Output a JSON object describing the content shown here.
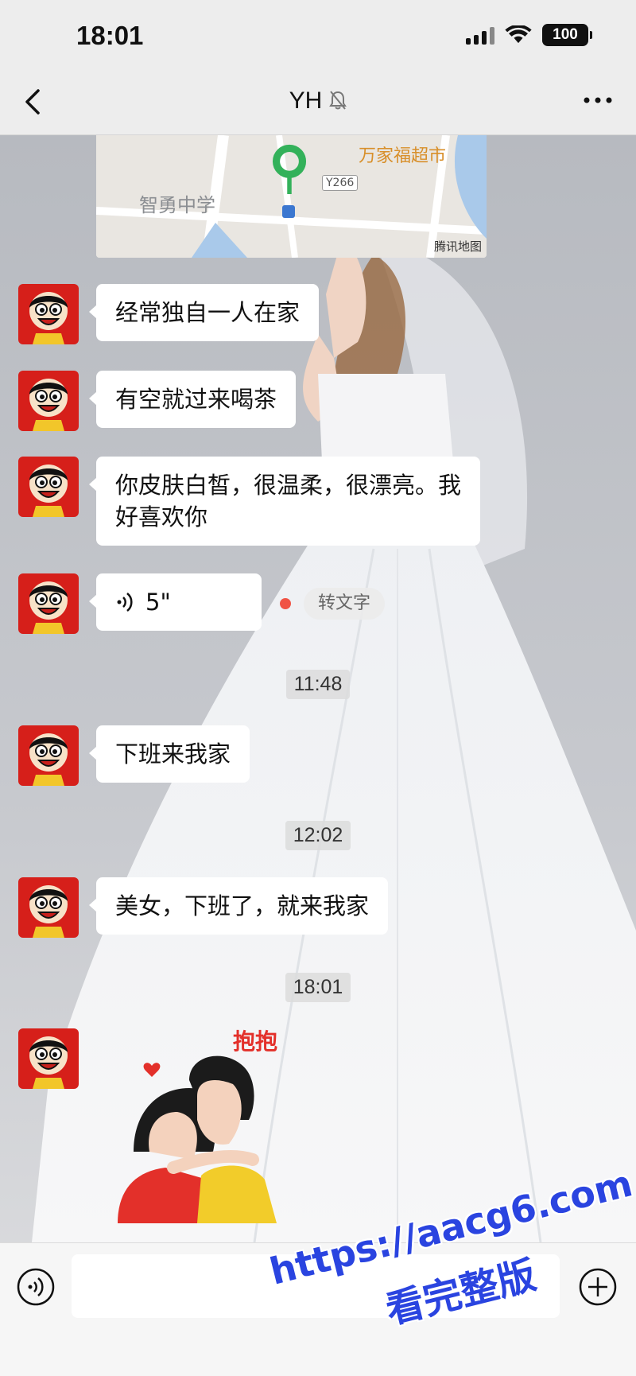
{
  "status_bar": {
    "time": "18:01",
    "battery": "100"
  },
  "nav": {
    "title": "YH"
  },
  "map": {
    "school_label": "智勇中学",
    "market_label": "万家福超市",
    "road_label": "Y266",
    "brand": "腾讯地图"
  },
  "messages": [
    {
      "type": "text",
      "text": "经常独自一人在家"
    },
    {
      "type": "text",
      "text": "有空就过来喝茶"
    },
    {
      "type": "text",
      "lines": [
        "你皮肤白皙，很温柔，很漂亮。我",
        "好喜欢你"
      ]
    },
    {
      "type": "voice",
      "duration": "5\"",
      "action": "转文字"
    },
    {
      "type": "time",
      "text": "11:48"
    },
    {
      "type": "text",
      "text": "下班来我家"
    },
    {
      "type": "time",
      "text": "12:02"
    },
    {
      "type": "text",
      "text": "美女，下班了，就来我家"
    },
    {
      "type": "time",
      "text": "18:01"
    },
    {
      "type": "sticker",
      "caption": "抱抱"
    }
  ],
  "input": {
    "value": "",
    "placeholder": ""
  },
  "watermark": {
    "url": "https://aacg6.com",
    "text": "看完整版"
  },
  "colors": {
    "accent_red": "#d61f1a",
    "unread_dot": "#f05344",
    "watermark": "#2a44e0"
  }
}
